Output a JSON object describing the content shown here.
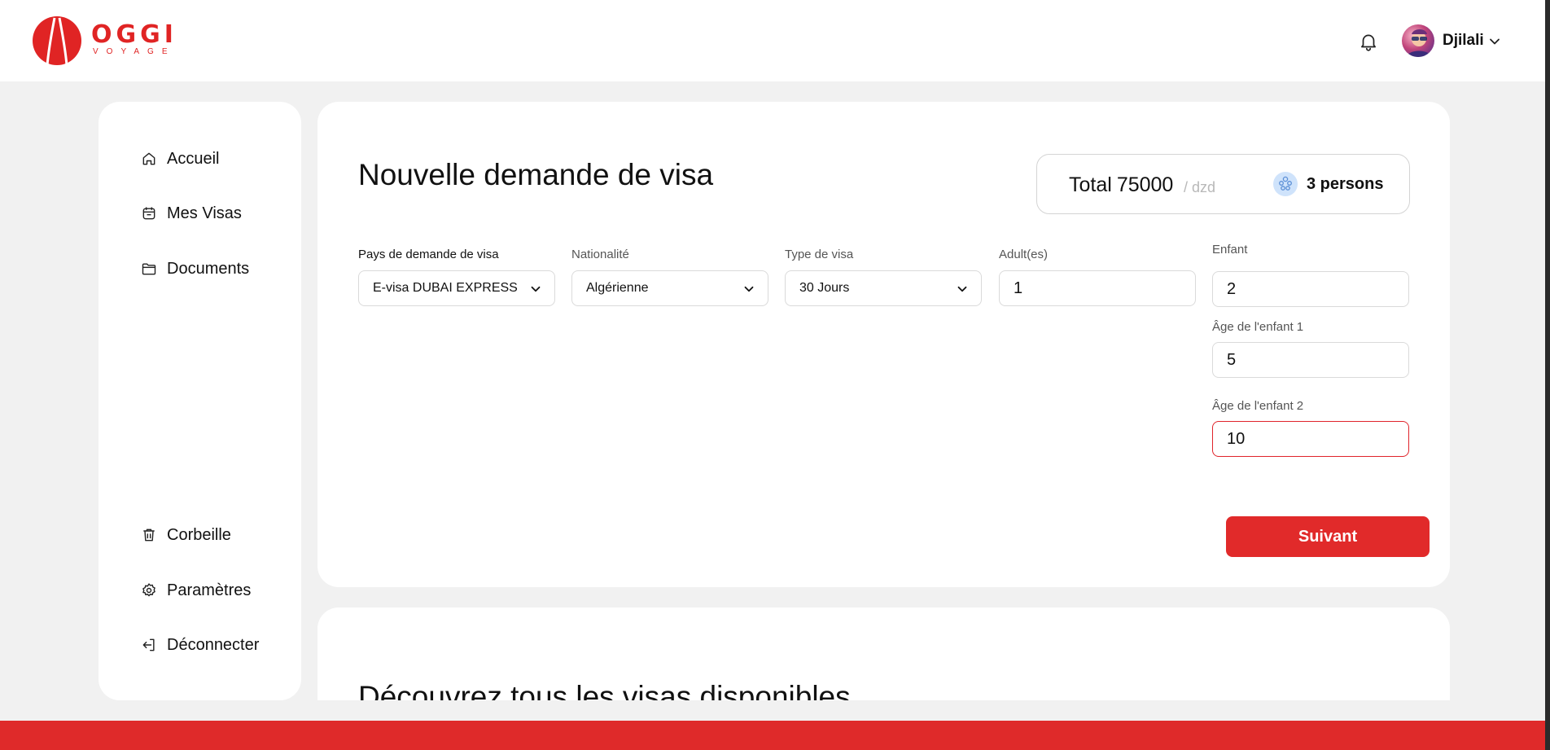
{
  "brand": {
    "name": "OGGI",
    "subtitle": "VOYAGE",
    "accent_color": "#e02424",
    "logo_icon": "arch-logo-icon"
  },
  "header": {
    "notification_icon": "bell-icon",
    "user": {
      "name": "Djilali",
      "avatar_icon": "avatar",
      "menu_icon": "chevron-down-icon"
    }
  },
  "sidebar": {
    "top_items": [
      {
        "label": "Accueil",
        "icon": "home-icon"
      },
      {
        "label": "Mes Visas",
        "icon": "calendar-icon"
      },
      {
        "label": "Documents",
        "icon": "folder-icon"
      }
    ],
    "bottom_items": [
      {
        "label": "Corbeille",
        "icon": "trash-icon"
      },
      {
        "label": "Paramètres",
        "icon": "gear-icon"
      },
      {
        "label": "Déconnecter",
        "icon": "logout-icon"
      }
    ]
  },
  "form": {
    "title": "Nouvelle demande de visa",
    "total": {
      "label": "Total",
      "amount": "75000",
      "unit": "/ dzd",
      "persons": "3 persons",
      "persons_icon": "people-icon"
    },
    "fields": {
      "country": {
        "label": "Pays de demande de visa",
        "value": "E-visa DUBAI EXPRESS"
      },
      "nationality": {
        "label": "Nationalité",
        "value": "Algérienne"
      },
      "visa_type": {
        "label": "Type de visa",
        "value": "30 Jours"
      },
      "adults": {
        "label": "Adult(es)",
        "value": "1"
      },
      "children": {
        "label": "Enfant",
        "value": "2"
      },
      "child_1_age": {
        "label": "Âge de l'enfant 1",
        "value": "5"
      },
      "child_2_age": {
        "label": "Âge de l'enfant 2",
        "value": "10"
      }
    },
    "next_button": "Suivant",
    "error_color": "#e0242b"
  },
  "section2": {
    "title": "Découvrez tous les visas disponibles"
  },
  "footer": {
    "bar_color": "#df2a2a"
  }
}
